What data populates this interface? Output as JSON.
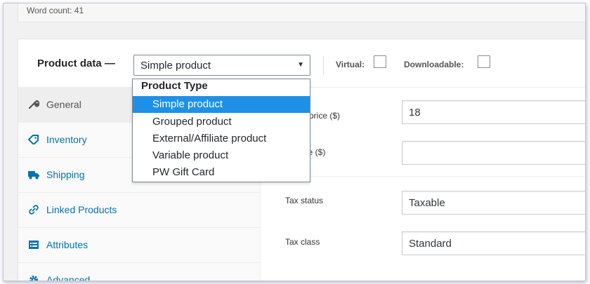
{
  "word_count": "Word count: 41",
  "product_data": {
    "label": "Product data —",
    "type_select": {
      "selected": "Simple product"
    },
    "virtual_label": "Virtual:",
    "downloadable_label": "Downloadable:",
    "virtual_checked": false,
    "downloadable_checked": false
  },
  "tabs": [
    {
      "label": "General",
      "icon": "wrench-icon",
      "active": true
    },
    {
      "label": "Inventory",
      "icon": "tag-icon",
      "active": false
    },
    {
      "label": "Shipping",
      "icon": "truck-icon",
      "active": false
    },
    {
      "label": "Linked Products",
      "icon": "link-icon",
      "active": false
    },
    {
      "label": "Attributes",
      "icon": "list-icon",
      "active": false
    },
    {
      "label": "Advanced",
      "icon": "gear-icon",
      "active": false
    }
  ],
  "general": {
    "regular_price_label": "ar price ($)",
    "regular_price_value": "18",
    "sale_price_label": "rice ($)",
    "sale_price_value": "",
    "tax_status_label": "Tax status",
    "tax_status_value": "Taxable",
    "tax_class_label": "Tax class",
    "tax_class_value": "Standard"
  },
  "dropdown": {
    "group": "Product Type",
    "options": [
      {
        "label": "Simple product",
        "selected": true
      },
      {
        "label": "Grouped product",
        "selected": false
      },
      {
        "label": "External/Affiliate product",
        "selected": false
      },
      {
        "label": "Variable product",
        "selected": false
      },
      {
        "label": "PW Gift Card",
        "selected": false
      }
    ]
  },
  "colors": {
    "link": "#0073aa",
    "highlight": "#1e90e6",
    "frame_shadow": "#7a6ea0"
  }
}
